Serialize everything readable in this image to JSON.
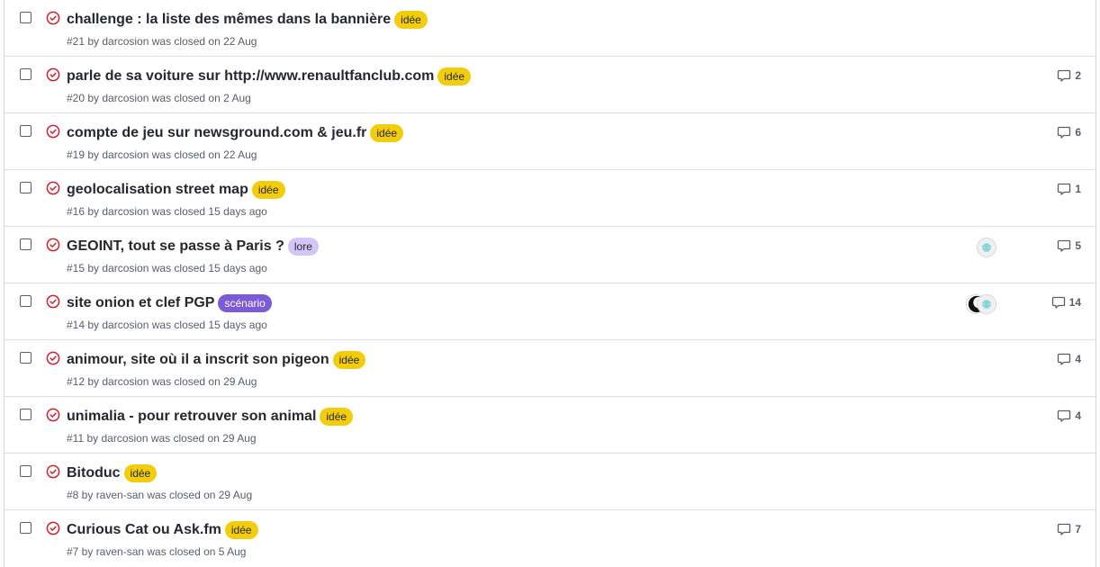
{
  "issues": [
    {
      "title": "challenge : la liste des mêmes dans la bannière",
      "label": "idée",
      "label_color": "#f3cc0b",
      "label_text_color": "#24292f",
      "meta": "#21 by darcosion was closed on 22 Aug",
      "comments": "",
      "avatars": []
    },
    {
      "title": "parle de sa voiture sur http://www.renaultfanclub.com",
      "label": "idée",
      "label_color": "#f3cc0b",
      "label_text_color": "#24292f",
      "meta": "#20 by darcosion was closed on 2 Aug",
      "comments": "2",
      "avatars": []
    },
    {
      "title": "compte de jeu sur newsground.com & jeu.fr",
      "label": "idée",
      "label_color": "#f3cc0b",
      "label_text_color": "#24292f",
      "meta": "#19 by darcosion was closed on 22 Aug",
      "comments": "6",
      "avatars": []
    },
    {
      "title": "geolocalisation street map",
      "label": "idée",
      "label_color": "#f3cc0b",
      "label_text_color": "#24292f",
      "meta": "#16 by darcosion was closed 15 days ago",
      "comments": "1",
      "avatars": []
    },
    {
      "title": "GEOINT, tout se passe à Paris ?",
      "label": "lore",
      "label_color": "#d4c5f9",
      "label_text_color": "#24292f",
      "meta": "#15 by darcosion was closed 15 days ago",
      "comments": "5",
      "avatars": [
        "identicon-teal"
      ]
    },
    {
      "title": "site onion et clef PGP",
      "label": "scénario",
      "label_color": "#7e5bd6",
      "label_text_color": "#ffffff",
      "meta": "#14 by darcosion was closed 15 days ago",
      "comments": "14",
      "avatars": [
        "identicon-teal",
        "avatar-dark"
      ]
    },
    {
      "title": "animour, site où il a inscrit son pigeon",
      "label": "idée",
      "label_color": "#f3cc0b",
      "label_text_color": "#24292f",
      "meta": "#12 by darcosion was closed on 29 Aug",
      "comments": "4",
      "avatars": []
    },
    {
      "title": "unimalia - pour retrouver son animal",
      "label": "idée",
      "label_color": "#f3cc0b",
      "label_text_color": "#24292f",
      "meta": "#11 by darcosion was closed on 29 Aug",
      "comments": "4",
      "avatars": []
    },
    {
      "title": "Bitoduc",
      "label": "idée",
      "label_color": "#f3cc0b",
      "label_text_color": "#24292f",
      "meta": "#8 by raven-san was closed on 29 Aug",
      "comments": "",
      "avatars": []
    },
    {
      "title": "Curious Cat ou Ask.fm",
      "label": "idée",
      "label_color": "#f3cc0b",
      "label_text_color": "#24292f",
      "meta": "#7 by raven-san was closed on 5 Aug",
      "comments": "7",
      "avatars": []
    }
  ],
  "icons": {
    "state": "closed-issue-check-icon",
    "comment": "comment-icon"
  },
  "colors": {
    "closed_state": "#cf222e",
    "muted_text": "#57606a",
    "border": "#d8dee4"
  }
}
